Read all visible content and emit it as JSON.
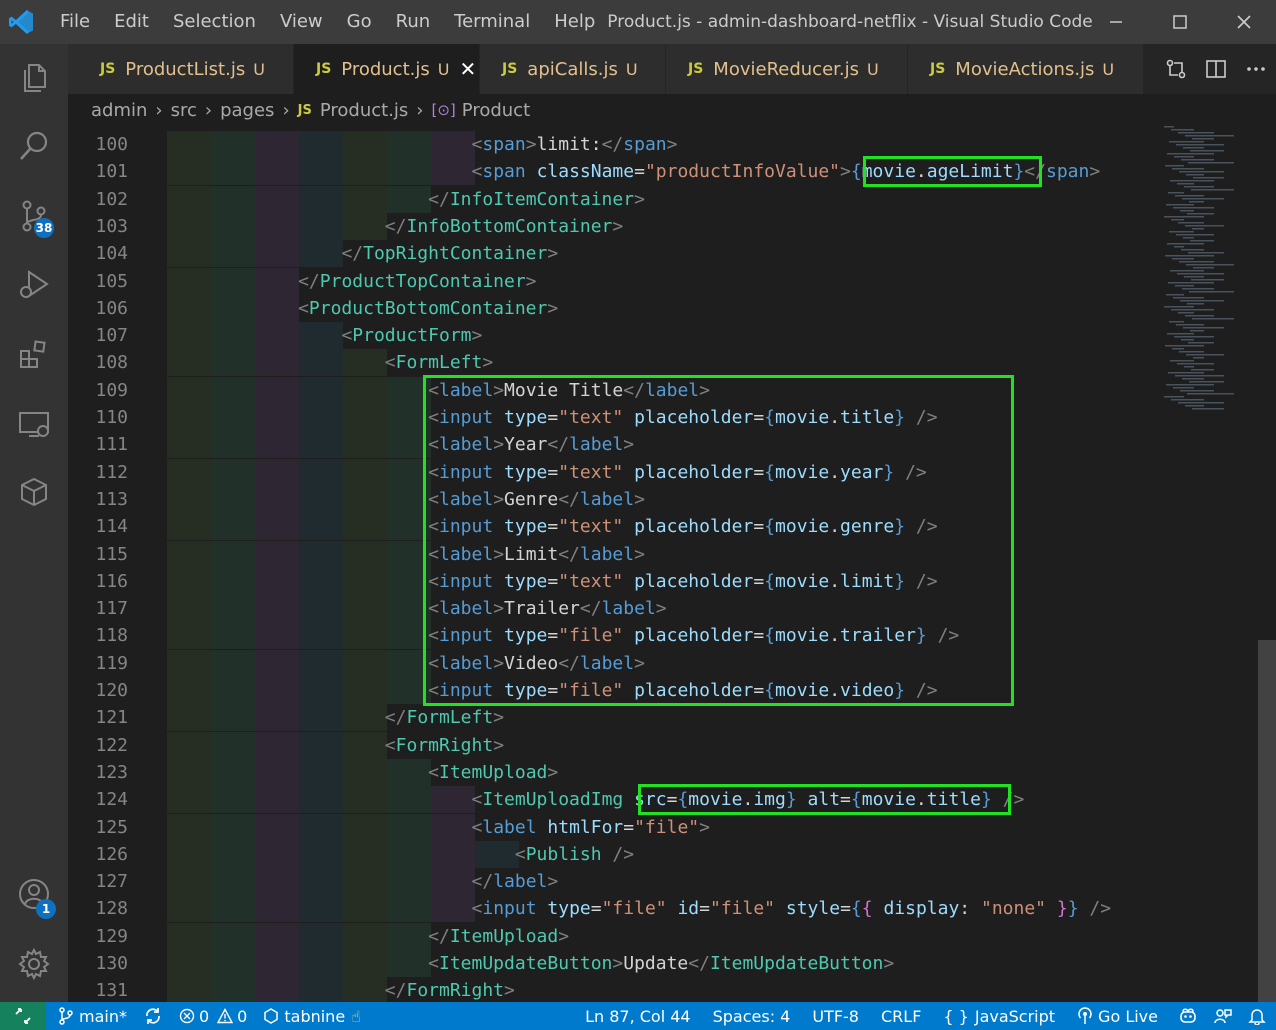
{
  "window": {
    "title": "Product.js - admin-dashboard-netflix - Visual Studio Code"
  },
  "menu": [
    "File",
    "Edit",
    "Selection",
    "View",
    "Go",
    "Run",
    "Terminal",
    "Help"
  ],
  "activity_bar": {
    "source_control_badge": "38",
    "accounts_badge": "1"
  },
  "tabs": [
    {
      "label": "ProductList.js",
      "status": "U",
      "active": false
    },
    {
      "label": "Product.js",
      "status": "U",
      "active": true
    },
    {
      "label": "apiCalls.js",
      "status": "U",
      "active": false
    },
    {
      "label": "MovieReducer.js",
      "status": "U",
      "active": false
    },
    {
      "label": "MovieActions.js",
      "status": "U",
      "active": false
    }
  ],
  "file_icon_text": "JS",
  "breadcrumb": {
    "items": [
      "admin",
      "src",
      "pages",
      "Product.js",
      "Product"
    ]
  },
  "editor": {
    "lines": [
      {
        "n": "100",
        "tokens": [
          [
            "t",
            "<"
          ],
          [
            "htag",
            "span"
          ],
          [
            "t",
            ">"
          ],
          [
            "txt",
            "limit:"
          ],
          [
            "t",
            "</"
          ],
          [
            "htag",
            "span"
          ],
          [
            "t",
            ">"
          ]
        ]
      },
      {
        "n": "101",
        "tokens": [
          [
            "t",
            "<"
          ],
          [
            "htag",
            "span"
          ],
          [
            "txt",
            " "
          ],
          [
            "attr",
            "className"
          ],
          [
            "txt",
            "="
          ],
          [
            "str",
            "\"productInfoValue\""
          ],
          [
            "t",
            ">"
          ],
          [
            "brace",
            "{"
          ],
          [
            "jsv",
            "movie"
          ],
          [
            "txt",
            "."
          ],
          [
            "jsv",
            "ageLimit"
          ],
          [
            "brace",
            "}"
          ],
          [
            "t",
            "</"
          ],
          [
            "htag",
            "span"
          ],
          [
            "t",
            ">"
          ]
        ]
      },
      {
        "n": "102",
        "tokens": [
          [
            "t",
            "</"
          ],
          [
            "tag",
            "InfoItemContainer"
          ],
          [
            "t",
            ">"
          ]
        ]
      },
      {
        "n": "103",
        "tokens": [
          [
            "t",
            "</"
          ],
          [
            "tag",
            "InfoBottomContainer"
          ],
          [
            "t",
            ">"
          ]
        ]
      },
      {
        "n": "104",
        "tokens": [
          [
            "t",
            "</"
          ],
          [
            "tag",
            "TopRightContainer"
          ],
          [
            "t",
            ">"
          ]
        ]
      },
      {
        "n": "105",
        "tokens": [
          [
            "t",
            "</"
          ],
          [
            "tag",
            "ProductTopContainer"
          ],
          [
            "t",
            ">"
          ]
        ]
      },
      {
        "n": "106",
        "tokens": [
          [
            "t",
            "<"
          ],
          [
            "tag",
            "ProductBottomContainer"
          ],
          [
            "t",
            ">"
          ]
        ]
      },
      {
        "n": "107",
        "tokens": [
          [
            "t",
            "<"
          ],
          [
            "tag",
            "ProductForm"
          ],
          [
            "t",
            ">"
          ]
        ]
      },
      {
        "n": "108",
        "tokens": [
          [
            "t",
            "<"
          ],
          [
            "tag",
            "FormLeft"
          ],
          [
            "t",
            ">"
          ]
        ]
      },
      {
        "n": "109",
        "tokens": [
          [
            "t",
            "<"
          ],
          [
            "htag",
            "label"
          ],
          [
            "t",
            ">"
          ],
          [
            "txt",
            "Movie Title"
          ],
          [
            "t",
            "</"
          ],
          [
            "htag",
            "label"
          ],
          [
            "t",
            ">"
          ]
        ]
      },
      {
        "n": "110",
        "tokens": [
          [
            "t",
            "<"
          ],
          [
            "htag",
            "input"
          ],
          [
            "txt",
            " "
          ],
          [
            "attr",
            "type"
          ],
          [
            "txt",
            "="
          ],
          [
            "str",
            "\"text\""
          ],
          [
            "txt",
            " "
          ],
          [
            "attr",
            "placeholder"
          ],
          [
            "txt",
            "="
          ],
          [
            "brace",
            "{"
          ],
          [
            "jsv",
            "movie"
          ],
          [
            "txt",
            "."
          ],
          [
            "jsv",
            "title"
          ],
          [
            "brace",
            "}"
          ],
          [
            "txt",
            " "
          ],
          [
            "t",
            "/>"
          ]
        ]
      },
      {
        "n": "111",
        "tokens": [
          [
            "t",
            "<"
          ],
          [
            "htag",
            "label"
          ],
          [
            "t",
            ">"
          ],
          [
            "txt",
            "Year"
          ],
          [
            "t",
            "</"
          ],
          [
            "htag",
            "label"
          ],
          [
            "t",
            ">"
          ]
        ]
      },
      {
        "n": "112",
        "tokens": [
          [
            "t",
            "<"
          ],
          [
            "htag",
            "input"
          ],
          [
            "txt",
            " "
          ],
          [
            "attr",
            "type"
          ],
          [
            "txt",
            "="
          ],
          [
            "str",
            "\"text\""
          ],
          [
            "txt",
            " "
          ],
          [
            "attr",
            "placeholder"
          ],
          [
            "txt",
            "="
          ],
          [
            "brace",
            "{"
          ],
          [
            "jsv",
            "movie"
          ],
          [
            "txt",
            "."
          ],
          [
            "jsv",
            "year"
          ],
          [
            "brace",
            "}"
          ],
          [
            "txt",
            " "
          ],
          [
            "t",
            "/>"
          ]
        ]
      },
      {
        "n": "113",
        "tokens": [
          [
            "t",
            "<"
          ],
          [
            "htag",
            "label"
          ],
          [
            "t",
            ">"
          ],
          [
            "txt",
            "Genre"
          ],
          [
            "t",
            "</"
          ],
          [
            "htag",
            "label"
          ],
          [
            "t",
            ">"
          ]
        ]
      },
      {
        "n": "114",
        "tokens": [
          [
            "t",
            "<"
          ],
          [
            "htag",
            "input"
          ],
          [
            "txt",
            " "
          ],
          [
            "attr",
            "type"
          ],
          [
            "txt",
            "="
          ],
          [
            "str",
            "\"text\""
          ],
          [
            "txt",
            " "
          ],
          [
            "attr",
            "placeholder"
          ],
          [
            "txt",
            "="
          ],
          [
            "brace",
            "{"
          ],
          [
            "jsv",
            "movie"
          ],
          [
            "txt",
            "."
          ],
          [
            "jsv",
            "genre"
          ],
          [
            "brace",
            "}"
          ],
          [
            "txt",
            " "
          ],
          [
            "t",
            "/>"
          ]
        ]
      },
      {
        "n": "115",
        "tokens": [
          [
            "t",
            "<"
          ],
          [
            "htag",
            "label"
          ],
          [
            "t",
            ">"
          ],
          [
            "txt",
            "Limit"
          ],
          [
            "t",
            "</"
          ],
          [
            "htag",
            "label"
          ],
          [
            "t",
            ">"
          ]
        ]
      },
      {
        "n": "116",
        "tokens": [
          [
            "t",
            "<"
          ],
          [
            "htag",
            "input"
          ],
          [
            "txt",
            " "
          ],
          [
            "attr",
            "type"
          ],
          [
            "txt",
            "="
          ],
          [
            "str",
            "\"text\""
          ],
          [
            "txt",
            " "
          ],
          [
            "attr",
            "placeholder"
          ],
          [
            "txt",
            "="
          ],
          [
            "brace",
            "{"
          ],
          [
            "jsv",
            "movie"
          ],
          [
            "txt",
            "."
          ],
          [
            "jsv",
            "limit"
          ],
          [
            "brace",
            "}"
          ],
          [
            "txt",
            " "
          ],
          [
            "t",
            "/>"
          ]
        ]
      },
      {
        "n": "117",
        "tokens": [
          [
            "t",
            "<"
          ],
          [
            "htag",
            "label"
          ],
          [
            "t",
            ">"
          ],
          [
            "txt",
            "Trailer"
          ],
          [
            "t",
            "</"
          ],
          [
            "htag",
            "label"
          ],
          [
            "t",
            ">"
          ]
        ]
      },
      {
        "n": "118",
        "tokens": [
          [
            "t",
            "<"
          ],
          [
            "htag",
            "input"
          ],
          [
            "txt",
            " "
          ],
          [
            "attr",
            "type"
          ],
          [
            "txt",
            "="
          ],
          [
            "str",
            "\"file\""
          ],
          [
            "txt",
            " "
          ],
          [
            "attr",
            "placeholder"
          ],
          [
            "txt",
            "="
          ],
          [
            "brace",
            "{"
          ],
          [
            "jsv",
            "movie"
          ],
          [
            "txt",
            "."
          ],
          [
            "jsv",
            "trailer"
          ],
          [
            "brace",
            "}"
          ],
          [
            "txt",
            " "
          ],
          [
            "t",
            "/>"
          ]
        ]
      },
      {
        "n": "119",
        "tokens": [
          [
            "t",
            "<"
          ],
          [
            "htag",
            "label"
          ],
          [
            "t",
            ">"
          ],
          [
            "txt",
            "Video"
          ],
          [
            "t",
            "</"
          ],
          [
            "htag",
            "label"
          ],
          [
            "t",
            ">"
          ]
        ]
      },
      {
        "n": "120",
        "tokens": [
          [
            "t",
            "<"
          ],
          [
            "htag",
            "input"
          ],
          [
            "txt",
            " "
          ],
          [
            "attr",
            "type"
          ],
          [
            "txt",
            "="
          ],
          [
            "str",
            "\"file\""
          ],
          [
            "txt",
            " "
          ],
          [
            "attr",
            "placeholder"
          ],
          [
            "txt",
            "="
          ],
          [
            "brace",
            "{"
          ],
          [
            "jsv",
            "movie"
          ],
          [
            "txt",
            "."
          ],
          [
            "jsv",
            "video"
          ],
          [
            "brace",
            "}"
          ],
          [
            "txt",
            " "
          ],
          [
            "t",
            "/>"
          ]
        ]
      },
      {
        "n": "121",
        "tokens": [
          [
            "t",
            "</"
          ],
          [
            "tag",
            "FormLeft"
          ],
          [
            "t",
            ">"
          ]
        ]
      },
      {
        "n": "122",
        "tokens": [
          [
            "t",
            "<"
          ],
          [
            "tag",
            "FormRight"
          ],
          [
            "t",
            ">"
          ]
        ]
      },
      {
        "n": "123",
        "tokens": [
          [
            "t",
            "<"
          ],
          [
            "tag",
            "ItemUpload"
          ],
          [
            "t",
            ">"
          ]
        ]
      },
      {
        "n": "124",
        "tokens": [
          [
            "t",
            "<"
          ],
          [
            "tag",
            "ItemUploadImg"
          ],
          [
            "txt",
            " "
          ],
          [
            "attr",
            "src"
          ],
          [
            "txt",
            "="
          ],
          [
            "brace",
            "{"
          ],
          [
            "jsv",
            "movie"
          ],
          [
            "txt",
            "."
          ],
          [
            "jsv",
            "img"
          ],
          [
            "brace",
            "}"
          ],
          [
            "txt",
            " "
          ],
          [
            "attr",
            "alt"
          ],
          [
            "txt",
            "="
          ],
          [
            "brace",
            "{"
          ],
          [
            "jsv",
            "movie"
          ],
          [
            "txt",
            "."
          ],
          [
            "jsv",
            "title"
          ],
          [
            "brace",
            "}"
          ],
          [
            "txt",
            " "
          ],
          [
            "t",
            "/>"
          ]
        ]
      },
      {
        "n": "125",
        "tokens": [
          [
            "t",
            "<"
          ],
          [
            "htag",
            "label"
          ],
          [
            "txt",
            " "
          ],
          [
            "attr",
            "htmlFor"
          ],
          [
            "txt",
            "="
          ],
          [
            "str",
            "\"file\""
          ],
          [
            "t",
            ">"
          ]
        ]
      },
      {
        "n": "126",
        "tokens": [
          [
            "t",
            "<"
          ],
          [
            "tag",
            "Publish"
          ],
          [
            "txt",
            " "
          ],
          [
            "t",
            "/>"
          ]
        ]
      },
      {
        "n": "127",
        "tokens": [
          [
            "t",
            "</"
          ],
          [
            "htag",
            "label"
          ],
          [
            "t",
            ">"
          ]
        ]
      },
      {
        "n": "128",
        "tokens": [
          [
            "t",
            "<"
          ],
          [
            "htag",
            "input"
          ],
          [
            "txt",
            " "
          ],
          [
            "attr",
            "type"
          ],
          [
            "txt",
            "="
          ],
          [
            "str",
            "\"file\""
          ],
          [
            "txt",
            " "
          ],
          [
            "attr",
            "id"
          ],
          [
            "txt",
            "="
          ],
          [
            "str",
            "\"file\""
          ],
          [
            "txt",
            " "
          ],
          [
            "attr",
            "style"
          ],
          [
            "txt",
            "="
          ],
          [
            "brace",
            "{"
          ],
          [
            "brace2",
            "{"
          ],
          [
            "txt",
            " "
          ],
          [
            "attr",
            "display"
          ],
          [
            "txt",
            ": "
          ],
          [
            "str",
            "\"none\""
          ],
          [
            "txt",
            " "
          ],
          [
            "brace2",
            "}"
          ],
          [
            "brace",
            "}"
          ],
          [
            "txt",
            " "
          ],
          [
            "t",
            "/>"
          ]
        ]
      },
      {
        "n": "129",
        "tokens": [
          [
            "t",
            "</"
          ],
          [
            "tag",
            "ItemUpload"
          ],
          [
            "t",
            ">"
          ]
        ]
      },
      {
        "n": "130",
        "tokens": [
          [
            "t",
            "<"
          ],
          [
            "tag",
            "ItemUpdateButton"
          ],
          [
            "t",
            ">"
          ],
          [
            "txt",
            "Update"
          ],
          [
            "t",
            "</"
          ],
          [
            "tag",
            "ItemUpdateButton"
          ],
          [
            "t",
            ">"
          ]
        ]
      },
      {
        "n": "131",
        "tokens": [
          [
            "t",
            "</"
          ],
          [
            "tag",
            "FormRight"
          ],
          [
            "t",
            ">"
          ]
        ]
      }
    ]
  },
  "status_bar": {
    "branch": "main*",
    "errors": "0",
    "warnings": "0",
    "tabnine": "tabnine",
    "cursor": "Ln 87, Col 44",
    "spaces": "Spaces: 4",
    "encoding": "UTF-8",
    "eol": "CRLF",
    "language": "JavaScript",
    "golive": "Go Live"
  },
  "colors": {
    "highlight_box": "#22e022",
    "statusbar": "#007acc",
    "activitybar": "#333333"
  }
}
